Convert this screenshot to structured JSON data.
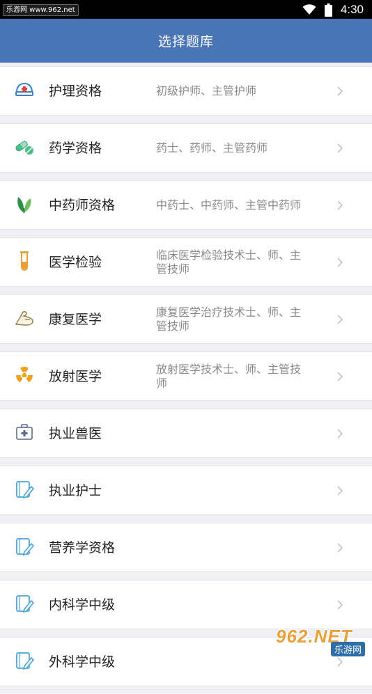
{
  "status_bar": {
    "left_text": "乐游网 www.962.net",
    "time": "4:30"
  },
  "app_bar": {
    "title": "选择题库"
  },
  "items": [
    {
      "title": "护理资格",
      "subtitle": "初级护师、主管护师",
      "icon": "nurse-cap-icon"
    },
    {
      "title": "药学资格",
      "subtitle": "药士、药师、主管药师",
      "icon": "pill-icon"
    },
    {
      "title": "中药师资格",
      "subtitle": "中药士、中药师、主管中药师",
      "icon": "herb-leaf-icon"
    },
    {
      "title": "医学检验",
      "subtitle": "临床医学检验技术士、师、主管技师",
      "icon": "test-tube-icon"
    },
    {
      "title": "康复医学",
      "subtitle": "康复医学治疗技术士、师、主管技师",
      "icon": "arm-muscle-icon"
    },
    {
      "title": "放射医学",
      "subtitle": "放射医学技术士、师、主管技师",
      "icon": "radiation-icon"
    },
    {
      "title": "执业兽医",
      "subtitle": "",
      "icon": "medical-kit-icon"
    },
    {
      "title": "执业护士",
      "subtitle": "",
      "icon": "notebook-pen-icon"
    },
    {
      "title": "营养学资格",
      "subtitle": "",
      "icon": "notebook-pen-icon"
    },
    {
      "title": "内科学中级",
      "subtitle": "",
      "icon": "notebook-pen-icon"
    },
    {
      "title": "外科学中级",
      "subtitle": "",
      "icon": "notebook-pen-icon"
    }
  ],
  "watermark": {
    "big": "962.NET",
    "small": "乐游网"
  },
  "colors": {
    "app_bar": "#4a76b6",
    "background": "#efeff4",
    "title_text": "#222222",
    "subtitle_text": "#8a8a8a"
  }
}
